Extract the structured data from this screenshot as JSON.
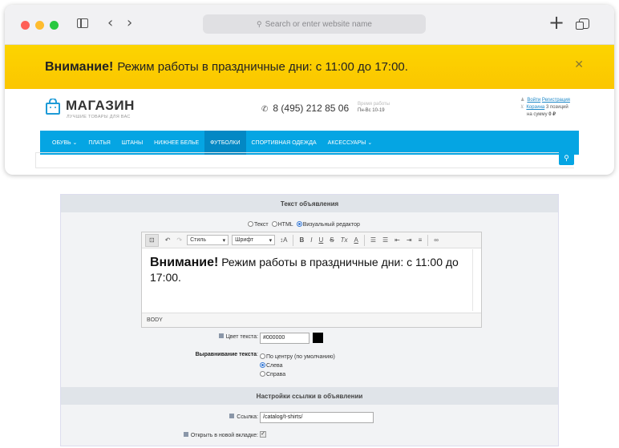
{
  "browser": {
    "url_placeholder": "Search or enter website name",
    "plus_label": "+"
  },
  "notice": {
    "bold": "Внимание!",
    "text": "Режим работы в праздничные дни: с 11:00 до 17:00.",
    "close": "✕"
  },
  "header": {
    "logo_title": "МАГАЗИН",
    "logo_subtitle": "ЛУЧШИЕ ТОВАРЫ ДЛЯ ВАС",
    "phone": "8 (495) 212 85 06",
    "hours_label": "Время работы",
    "hours_value": "Пн-Вс 10-19",
    "login": "Войти",
    "register": "Регистрация",
    "cart_link": "Корзина",
    "cart_count": "3 позиций",
    "cart_sum_prefix": "на сумму",
    "cart_sum": "0 ₽"
  },
  "menu": {
    "items": [
      {
        "label": "Обувь ⌄"
      },
      {
        "label": "Платья"
      },
      {
        "label": "Штаны"
      },
      {
        "label": "Нижнее белье"
      },
      {
        "label": "Футболки"
      },
      {
        "label": "Спортивная одежда"
      },
      {
        "label": "Аксессуары ⌄"
      }
    ]
  },
  "form": {
    "section1_title": "Текст объявления",
    "mode_text": "Текст",
    "mode_html": "HTML",
    "mode_visual": "Визуальный редактор",
    "toolbar": {
      "style": "Стиль",
      "font": "Шрифт",
      "size_icon": "↕A",
      "bold": "B",
      "italic": "I",
      "underline": "U",
      "strike": "S",
      "clear": "Tx",
      "color": "A"
    },
    "editor_bold": "Внимание!",
    "editor_text": "Режим работы в праздничные дни: с 11:00 до 17:00.",
    "status_path": "BODY",
    "color_label": "Цвет текста:",
    "color_value": "#000000",
    "align_label": "Выравнивание текста",
    "align_center": "По центру (по умолчанию)",
    "align_left": "Слева",
    "align_right": "Справа",
    "section2_title": "Настройки ссылки в объявлении",
    "link_label": "Ссылка:",
    "link_value": "/catalog/t-shirts/",
    "newtab_label": "Открыть в новой вкладке:"
  }
}
